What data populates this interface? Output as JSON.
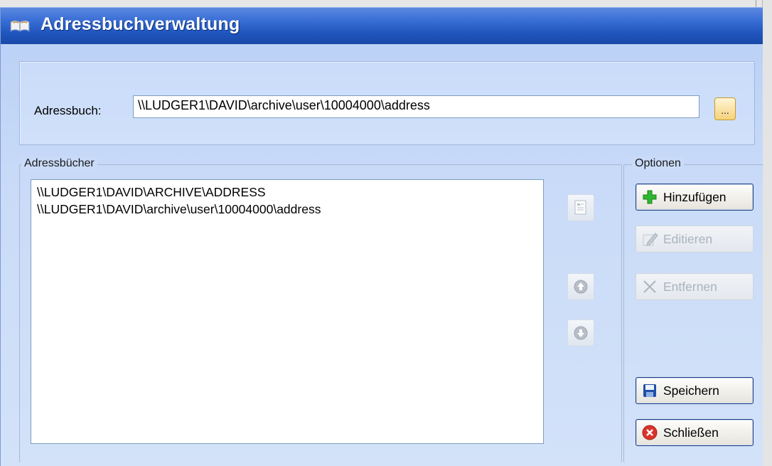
{
  "window": {
    "title": "Adressbuchverwaltung"
  },
  "address_book": {
    "label": "Adressbuch:",
    "value": "\\\\LUDGER1\\DAVID\\archive\\user\\10004000\\address",
    "browse_label": "..."
  },
  "books_group": {
    "legend": "Adressbücher",
    "items": [
      "\\\\LUDGER1\\DAVID\\ARCHIVE\\ADDRESS",
      "\\\\LUDGER1\\DAVID\\archive\\user\\10004000\\address"
    ]
  },
  "options_group": {
    "legend": "Optionen",
    "add_label": "Hinzufügen",
    "edit_label": "Editieren",
    "remove_label": "Entfernen",
    "save_label": "Speichern",
    "close_label": "Schließen"
  },
  "icons": {
    "properties": "properties-icon",
    "up": "arrow-up-icon",
    "down": "arrow-down-icon",
    "add": "plus-icon",
    "edit": "pencil-icon",
    "remove": "x-icon",
    "save": "floppy-disk-icon",
    "close": "close-icon"
  },
  "colors": {
    "titlebar": "#2f62cc",
    "window_bg": "#c9dbf8",
    "add_icon": "#2eb82e",
    "close_icon": "#d9342b",
    "save_icon": "#1f4fa8"
  }
}
